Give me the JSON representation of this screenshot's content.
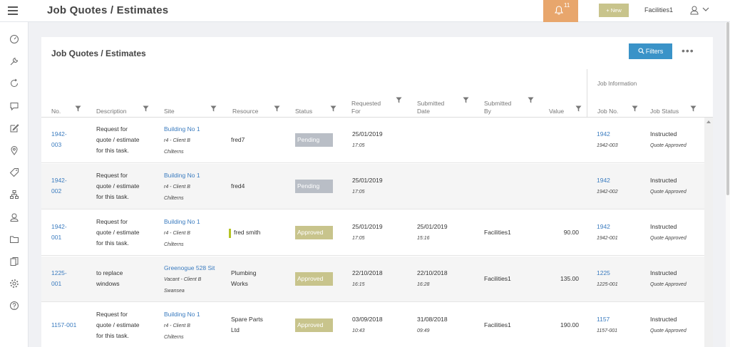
{
  "header": {
    "title": "Job Quotes / Estimates",
    "notification_count": "11",
    "new_label": "+ New",
    "user_name": "Facilities1"
  },
  "card": {
    "title": "Job Quotes / Estimates",
    "filters_label": "Filters",
    "more_label": "•••",
    "group_label": "Job Information"
  },
  "columns": {
    "no": "No.",
    "description": "Description",
    "site": "Site",
    "resource": "Resource",
    "status": "Status",
    "requested_1": "Requested",
    "requested_2": "For",
    "submitted_date_1": "Submitted",
    "submitted_date_2": "Date",
    "submitted_by_1": "Submitted",
    "submitted_by_2": "By",
    "value": "Value",
    "job_no": "Job No.",
    "job_status": "Job Status"
  },
  "rows": [
    {
      "no_1": "1942-",
      "no_2": "003",
      "desc_1": "Request for",
      "desc_2": "quote / estimate",
      "desc_3": "for this task.",
      "site": "Building No 1",
      "site_sub_1": "r4 - Client B",
      "site_sub_2": "Chilterns",
      "resource_1": "fred7",
      "resource_2": "",
      "status": "Pending",
      "req_date": "25/01/2019",
      "req_time": "17:05",
      "sub_date": "",
      "sub_time": "",
      "sub_by": "",
      "value": "",
      "job_no": "1942",
      "job_no_sub": "1942-003",
      "job_status": "Instructed",
      "job_status_sub": "Quote Approved"
    },
    {
      "no_1": "1942-",
      "no_2": "002",
      "desc_1": "Request for",
      "desc_2": "quote / estimate",
      "desc_3": "for this task.",
      "site": "Building No 1",
      "site_sub_1": "r4 - Client B",
      "site_sub_2": "Chilterns",
      "resource_1": "fred4",
      "resource_2": "",
      "status": "Pending",
      "req_date": "25/01/2019",
      "req_time": "17:05",
      "sub_date": "",
      "sub_time": "",
      "sub_by": "",
      "value": "",
      "job_no": "1942",
      "job_no_sub": "1942-002",
      "job_status": "Instructed",
      "job_status_sub": "Quote Approved"
    },
    {
      "no_1": "1942-",
      "no_2": "001",
      "desc_1": "Request for",
      "desc_2": "quote / estimate",
      "desc_3": "for this task.",
      "site": "Building No 1",
      "site_sub_1": "r4 - Client B",
      "site_sub_2": "Chilterns",
      "resource_1": "fred smith",
      "resource_2": "",
      "status": "Approved",
      "req_date": "25/01/2019",
      "req_time": "17:05",
      "sub_date": "25/01/2019",
      "sub_time": "15:16",
      "sub_by": "Facilities1",
      "value": "90.00",
      "job_no": "1942",
      "job_no_sub": "1942-001",
      "job_status": "Instructed",
      "job_status_sub": "Quote Approved"
    },
    {
      "no_1": "1225-",
      "no_2": "001",
      "desc_1": "to replace",
      "desc_2": "windows",
      "desc_3": "",
      "site": "Greenogue 528 Sit",
      "site_sub_1": "Vacant - Client B",
      "site_sub_2": "Swansea",
      "resource_1": "Plumbing",
      "resource_2": "Works",
      "status": "Approved",
      "req_date": "22/10/2018",
      "req_time": "16:15",
      "sub_date": "22/10/2018",
      "sub_time": "16:28",
      "sub_by": "Facilities1",
      "value": "135.00",
      "job_no": "1225",
      "job_no_sub": "1225-001",
      "job_status": "Instructed",
      "job_status_sub": "Quote Approved"
    },
    {
      "no_1": "1157-001",
      "no_2": "",
      "desc_1": "Request for",
      "desc_2": "quote / estimate",
      "desc_3": "for this task.",
      "site": "Building No 1",
      "site_sub_1": "r4 - Client B",
      "site_sub_2": "Chilterns",
      "resource_1": "Spare Parts",
      "resource_2": "Ltd",
      "status": "Approved",
      "req_date": "03/09/2018",
      "req_time": "10:43",
      "sub_date": "31/08/2018",
      "sub_time": "09:49",
      "sub_by": "Facilities1",
      "value": "190.00",
      "job_no": "1157",
      "job_no_sub": "1157-001",
      "job_status": "Instructed",
      "job_status_sub": "Quote Approved"
    }
  ],
  "colors": {
    "accent_blue": "#3a93c8",
    "link_blue": "#3a7bbf",
    "pending_badge": "#b9bec6",
    "approved_badge": "#c8c48c",
    "notification_orange": "#e8a66c",
    "resource_marker": "#b5c425"
  },
  "sidebar_icons": [
    "dashboard-icon",
    "wrench-icon",
    "refresh-icon",
    "chat-icon",
    "edit-icon",
    "location-pin-icon",
    "tag-icon",
    "hierarchy-icon",
    "contact-icon",
    "folder-icon",
    "documents-icon",
    "settings-icon",
    "help-icon"
  ]
}
